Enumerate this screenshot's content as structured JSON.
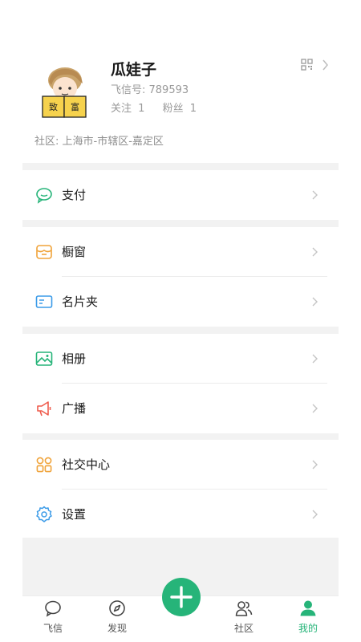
{
  "profile": {
    "name": "瓜娃子",
    "feixin_id_label": "飞信号: ",
    "feixin_id": "789593",
    "following_label": "关注",
    "following": "1",
    "followers_label": "粉丝",
    "followers": "1",
    "community": "社区: 上海市-市辖区-嘉定区",
    "avatar_book_text": [
      "致",
      "富"
    ]
  },
  "menu": {
    "groups": [
      [
        {
          "label": "支付",
          "icon": "chat-bubble-icon"
        }
      ],
      [
        {
          "label": "橱窗",
          "icon": "shop-window-icon"
        },
        {
          "label": "名片夹",
          "icon": "card-holder-icon"
        }
      ],
      [
        {
          "label": "相册",
          "icon": "photo-album-icon"
        },
        {
          "label": "广播",
          "icon": "megaphone-icon"
        }
      ],
      [
        {
          "label": "社交中心",
          "icon": "grid-icon"
        },
        {
          "label": "设置",
          "icon": "settings-icon"
        }
      ]
    ]
  },
  "tabbar": {
    "tabs": [
      {
        "label": "飞信",
        "icon": "chat-bubble-icon"
      },
      {
        "label": "发现",
        "icon": "compass-icon"
      },
      {
        "label": "社区",
        "icon": "people-icon"
      },
      {
        "label": "我的",
        "icon": "person-icon",
        "active": true
      }
    ],
    "fab_icon": "plus-icon"
  },
  "colors": {
    "accent": "#26b479",
    "pay_icon": "#26b479",
    "shop_icon": "#f0a33a",
    "card_icon": "#3b9be8",
    "album_icon": "#26b479",
    "broadcast_icon": "#ef5b4c",
    "social_icon": "#f0a33a",
    "settings_icon": "#3b9be8",
    "separator": "#f2f2f2"
  }
}
